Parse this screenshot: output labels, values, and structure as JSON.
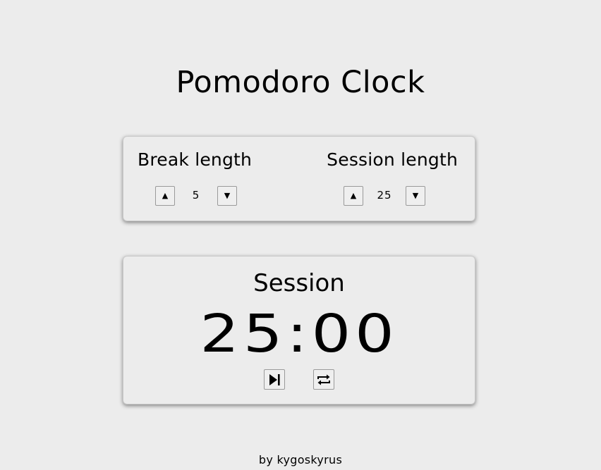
{
  "header": {
    "title": "Pomodoro Clock"
  },
  "settings": {
    "break": {
      "label": "Break length",
      "value": "5",
      "up_icon": "▲",
      "down_icon": "▼"
    },
    "session": {
      "label": "Session length",
      "value": "25",
      "up_icon": "▲",
      "down_icon": "▼"
    }
  },
  "timer": {
    "label": "Session",
    "time": "25:00",
    "controls": {
      "play_pause_icon": "play-pause-icon",
      "reset_icon": "repeat-icon"
    }
  },
  "footer": {
    "credit": "by kygoskyrus"
  }
}
